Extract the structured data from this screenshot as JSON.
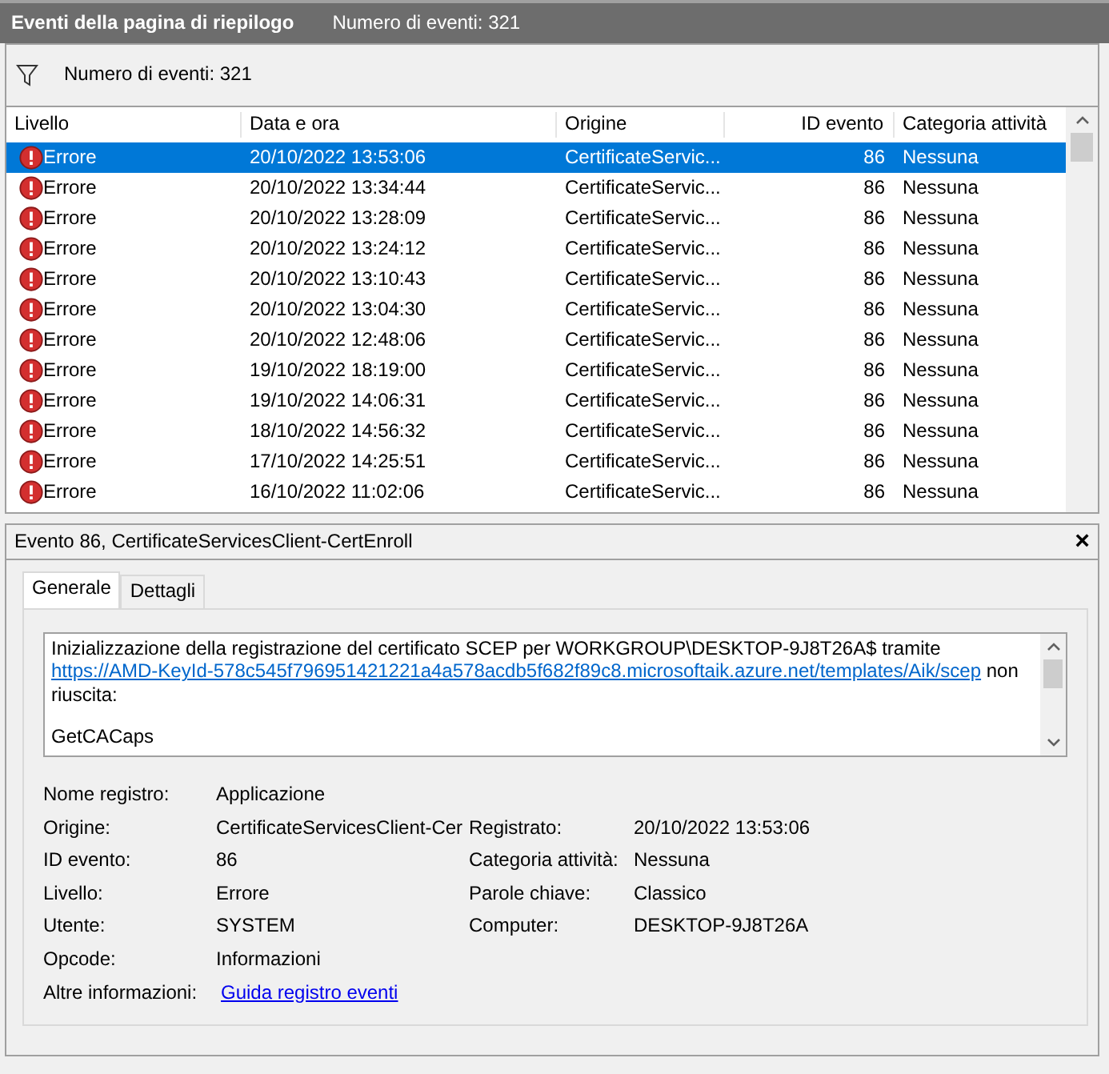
{
  "header": {
    "title": "Eventi della pagina di riepilogo",
    "count": "Numero di eventi: 321"
  },
  "filter": {
    "text": "Numero di eventi: 321"
  },
  "table": {
    "columns": [
      "Livello",
      "Data e ora",
      "Origine",
      "ID evento",
      "Categoria attività"
    ],
    "rows": [
      {
        "level": "Errore",
        "date": "20/10/2022 13:53:06",
        "source": "CertificateServic...",
        "id": "86",
        "category": "Nessuna",
        "selected": true
      },
      {
        "level": "Errore",
        "date": "20/10/2022 13:34:44",
        "source": "CertificateServic...",
        "id": "86",
        "category": "Nessuna",
        "selected": false
      },
      {
        "level": "Errore",
        "date": "20/10/2022 13:28:09",
        "source": "CertificateServic...",
        "id": "86",
        "category": "Nessuna",
        "selected": false
      },
      {
        "level": "Errore",
        "date": "20/10/2022 13:24:12",
        "source": "CertificateServic...",
        "id": "86",
        "category": "Nessuna",
        "selected": false
      },
      {
        "level": "Errore",
        "date": "20/10/2022 13:10:43",
        "source": "CertificateServic...",
        "id": "86",
        "category": "Nessuna",
        "selected": false
      },
      {
        "level": "Errore",
        "date": "20/10/2022 13:04:30",
        "source": "CertificateServic...",
        "id": "86",
        "category": "Nessuna",
        "selected": false
      },
      {
        "level": "Errore",
        "date": "20/10/2022 12:48:06",
        "source": "CertificateServic...",
        "id": "86",
        "category": "Nessuna",
        "selected": false
      },
      {
        "level": "Errore",
        "date": "19/10/2022 18:19:00",
        "source": "CertificateServic...",
        "id": "86",
        "category": "Nessuna",
        "selected": false
      },
      {
        "level": "Errore",
        "date": "19/10/2022 14:06:31",
        "source": "CertificateServic...",
        "id": "86",
        "category": "Nessuna",
        "selected": false
      },
      {
        "level": "Errore",
        "date": "18/10/2022 14:56:32",
        "source": "CertificateServic...",
        "id": "86",
        "category": "Nessuna",
        "selected": false
      },
      {
        "level": "Errore",
        "date": "17/10/2022 14:25:51",
        "source": "CertificateServic...",
        "id": "86",
        "category": "Nessuna",
        "selected": false
      },
      {
        "level": "Errore",
        "date": "16/10/2022 11:02:06",
        "source": "CertificateServic...",
        "id": "86",
        "category": "Nessuna",
        "selected": false
      }
    ]
  },
  "detail": {
    "title": "Evento 86, CertificateServicesClient-CertEnroll",
    "close": "×",
    "tabs": [
      {
        "label": "Generale",
        "selected": true
      },
      {
        "label": "Dettagli",
        "selected": false
      }
    ],
    "message": {
      "before": "Inizializzazione della registrazione del certificato SCEP per WORKGROUP\\DESKTOP-9J8T26A$ tramite",
      "link": "https://AMD-KeyId-578c545f796951421221a4a578acdb5f682f89c8.microsoftaik.azure.net/templates/Aik/scep",
      "after": "non riuscita:",
      "extra": "GetCACaps"
    },
    "fields": [
      {
        "label": "Nome registro:",
        "value": "Applicazione"
      },
      {
        "label": "Origine:",
        "value": "CertificateServicesClient-Cer",
        "label2": "Registrato:",
        "value2": "20/10/2022 13:53:06"
      },
      {
        "label": "ID evento:",
        "value": "86",
        "label2": "Categoria attività:",
        "value2": "Nessuna"
      },
      {
        "label": "Livello:",
        "value": "Errore",
        "label2": "Parole chiave:",
        "value2": "Classico"
      },
      {
        "label": "Utente:",
        "value": "SYSTEM",
        "label2": "Computer:",
        "value2": "DESKTOP-9J8T26A"
      },
      {
        "label": "Opcode:",
        "value": "Informazioni"
      },
      {
        "label": "Altre informazioni:",
        "link": "Guida registro eventi"
      }
    ]
  }
}
